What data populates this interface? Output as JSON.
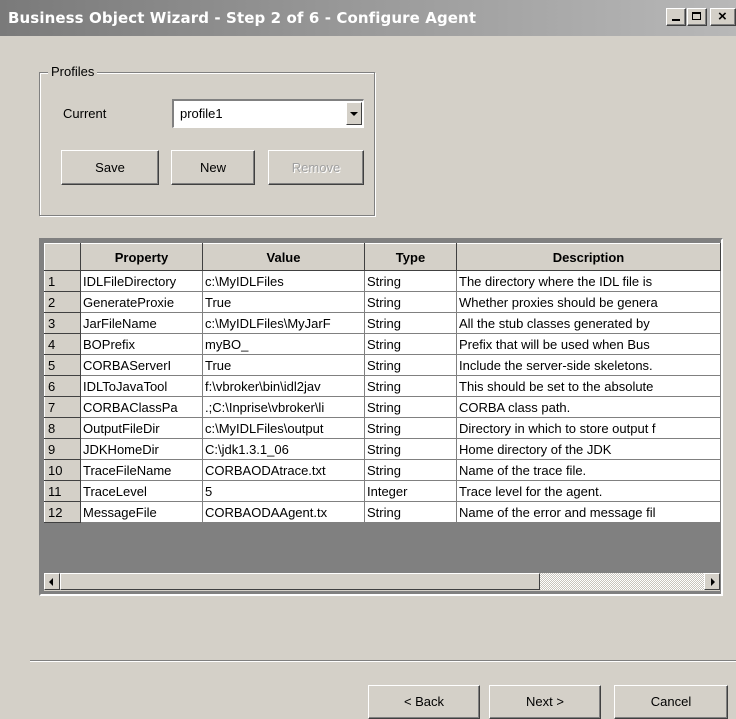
{
  "window": {
    "title": "Business Object Wizard - Step 2 of 6 - Configure Agent"
  },
  "profiles": {
    "group_label": "Profiles",
    "current_label": "Current",
    "current_value": "profile1",
    "save_label": "Save",
    "new_label": "New",
    "remove_label": "Remove"
  },
  "table": {
    "headers": [
      "",
      "Property",
      "Value",
      "Type",
      "Description"
    ],
    "rows": [
      {
        "n": "1",
        "property": "IDLFileDirectory",
        "value": "c:\\MyIDLFiles",
        "type": "String",
        "description": "The directory where the IDL file is"
      },
      {
        "n": "2",
        "property": "GenerateProxie",
        "value": "True",
        "type": "String",
        "description": "Whether proxies should be genera"
      },
      {
        "n": "3",
        "property": "JarFileName",
        "value": "c:\\MyIDLFiles\\MyJarF",
        "type": "String",
        "description": "All the stub classes generated by"
      },
      {
        "n": "4",
        "property": "BOPrefix",
        "value": "myBO_",
        "type": "String",
        "description": "Prefix that will be used when Bus"
      },
      {
        "n": "5",
        "property": "CORBAServerI",
        "value": "True",
        "type": "String",
        "description": "Include the server-side skeletons."
      },
      {
        "n": "6",
        "property": "IDLToJavaTool",
        "value": "f:\\vbroker\\bin\\idl2jav",
        "type": "String",
        "description": "This should be set to the absolute"
      },
      {
        "n": "7",
        "property": "CORBAClassPa",
        "value": ".;C:\\Inprise\\vbroker\\li",
        "type": "String",
        "description": "CORBA class path."
      },
      {
        "n": "8",
        "property": "OutputFileDir",
        "value": "c:\\MyIDLFiles\\output",
        "type": "String",
        "description": "Directory in which to store output f"
      },
      {
        "n": "9",
        "property": "JDKHomeDir",
        "value": "C:\\jdk1.3.1_06",
        "type": "String",
        "description": "Home directory of the JDK"
      },
      {
        "n": "10",
        "property": "TraceFileName",
        "value": "CORBAODAtrace.txt",
        "type": "String",
        "description": "Name of the trace file."
      },
      {
        "n": "11",
        "property": "TraceLevel",
        "value": "5",
        "type": "Integer",
        "description": "Trace level for the agent."
      },
      {
        "n": "12",
        "property": "MessageFile",
        "value": "CORBAODAAgent.tx",
        "type": "String",
        "description": "Name of the error and message fil"
      }
    ]
  },
  "footer": {
    "back_label": "< Back",
    "next_label": "Next >",
    "cancel_label": "Cancel"
  },
  "colors": {
    "window_bg": "#d4d0c8",
    "titlebar": "#8c8c8c"
  }
}
